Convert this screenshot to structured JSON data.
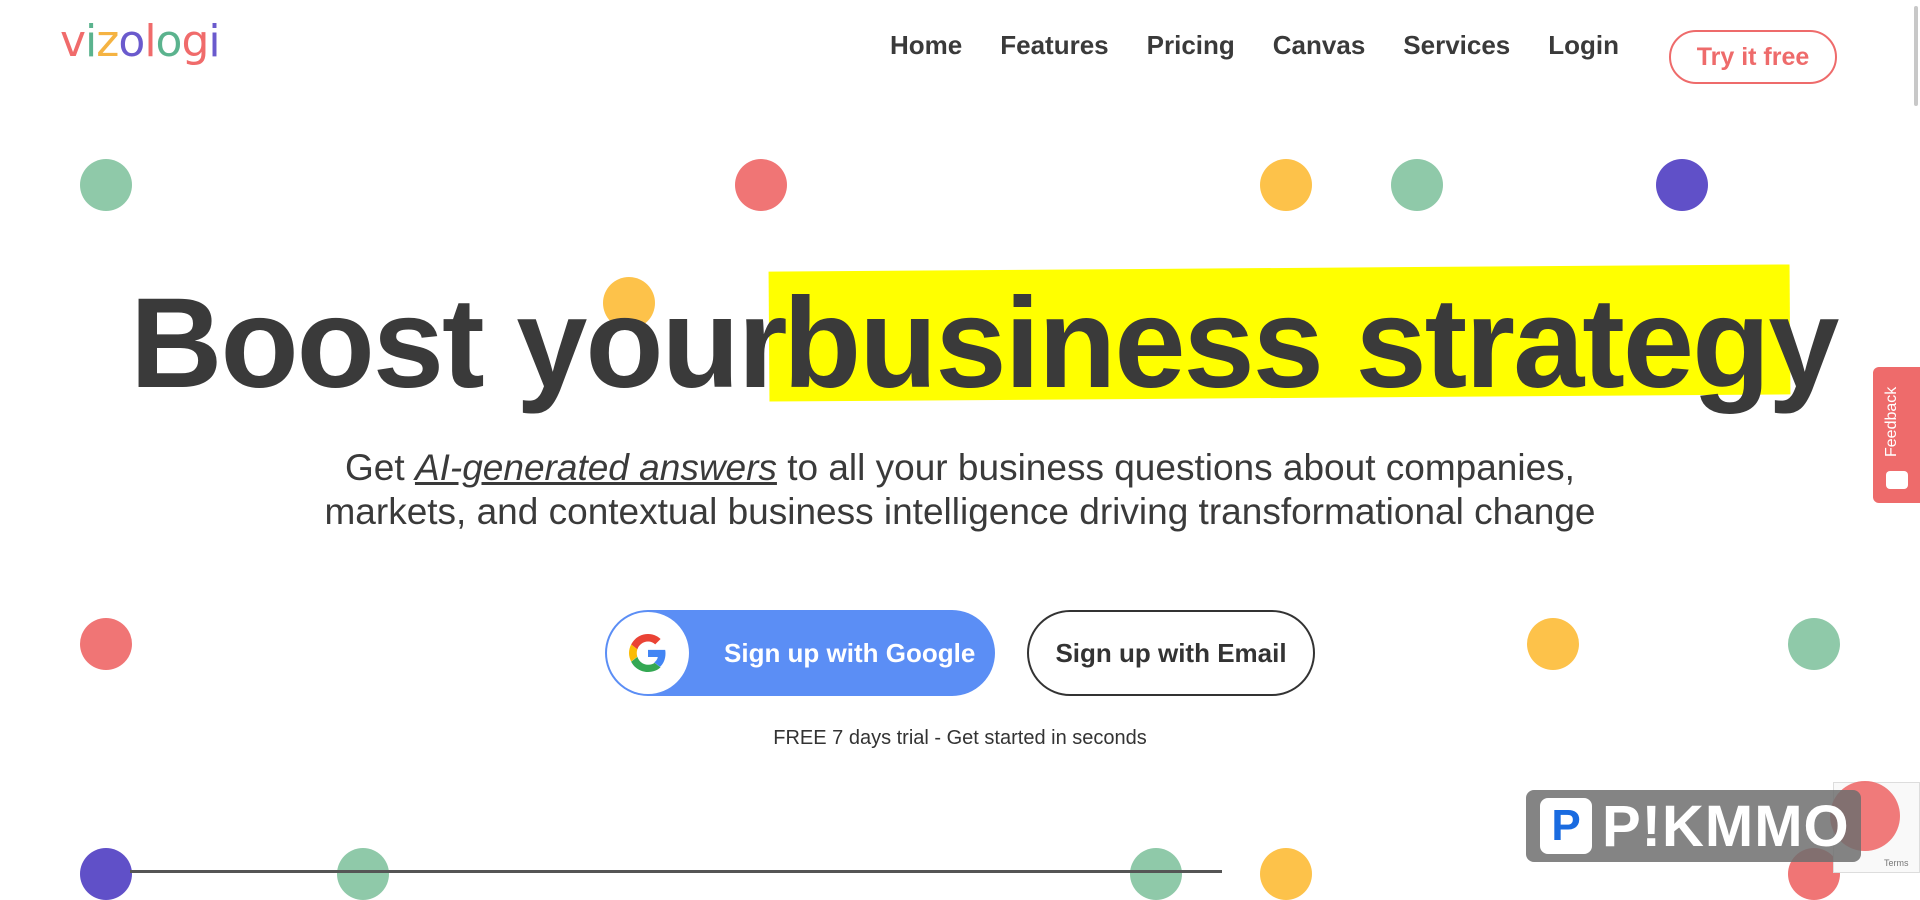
{
  "logo": {
    "letters": [
      {
        "ch": "v",
        "color": "#f06b6b"
      },
      {
        "ch": "i",
        "color": "#5bb38e"
      },
      {
        "ch": "z",
        "color": "#f5b342"
      },
      {
        "ch": "o",
        "color": "#6a5acd"
      },
      {
        "ch": "l",
        "color": "#f06b6b"
      },
      {
        "ch": "o",
        "color": "#5bb38e"
      },
      {
        "ch": "g",
        "color": "#f06b6b"
      },
      {
        "ch": "i",
        "color": "#6a5acd"
      }
    ]
  },
  "nav": {
    "items": [
      "Home",
      "Features",
      "Pricing",
      "Canvas",
      "Services",
      "Login"
    ],
    "cta": "Try it free"
  },
  "hero": {
    "headline_pre": "Boost your",
    "headline_highlight": "business strategy",
    "sub_before": "Get ",
    "sub_emphasis": "AI-generated answers",
    "sub_after": " to all your business questions about companies, markets, and contextual business intelligence driving transformational change",
    "google_button": "Sign up with Google",
    "email_button": "Sign up with Email",
    "trial_note": "FREE 7 days trial - Get started in seconds"
  },
  "feedback_tab": "Feedback",
  "watermark": "P!KMMO",
  "recaptcha_text": "Terms",
  "colors": {
    "green": "#8fc9a9",
    "red": "#f07575",
    "yellow": "#fdc24a",
    "purple": "#6050c8",
    "highlight": "#ffff00",
    "google_blue": "#5b8ef5",
    "accent": "#ee6b6b"
  }
}
